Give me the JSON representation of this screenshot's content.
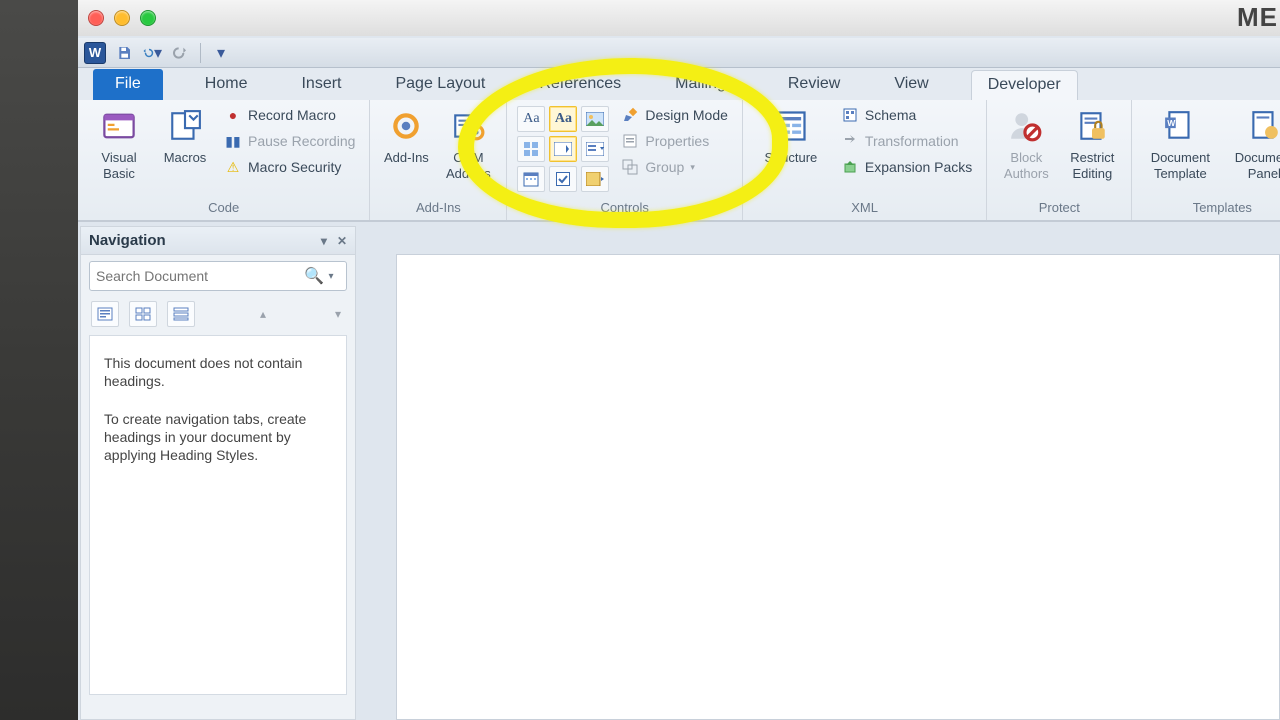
{
  "title_fragment": "ME",
  "tabs": {
    "file": "File",
    "list": [
      "Home",
      "Insert",
      "Page Layout",
      "References",
      "Mailings",
      "Review",
      "View",
      "Developer"
    ],
    "active": "Developer"
  },
  "ribbon": {
    "code": {
      "visual_basic": "Visual\nBasic",
      "macros": "Macros",
      "record": "Record Macro",
      "pause": "Pause Recording",
      "security": "Macro Security",
      "label": "Code"
    },
    "addins": {
      "addins": "Add-Ins",
      "com": "COM\nAdd-Ins",
      "label": "Add-Ins"
    },
    "controls": {
      "design": "Design Mode",
      "properties": "Properties",
      "group": "Group",
      "label": "Controls"
    },
    "xml": {
      "structure": "Structure",
      "schema": "Schema",
      "transformation": "Transformation",
      "expansion": "Expansion Packs",
      "label": "XML"
    },
    "protect": {
      "block": "Block\nAuthors",
      "restrict": "Restrict\nEditing",
      "label": "Protect"
    },
    "templates": {
      "doctpl": "Document\nTemplate",
      "docpanel": "Document\nPanel",
      "label": "Templates"
    }
  },
  "nav": {
    "title": "Navigation",
    "search_placeholder": "Search Document",
    "body1": "This document does not contain headings.",
    "body2": "To create navigation tabs, create headings in your document by applying Heading Styles."
  }
}
